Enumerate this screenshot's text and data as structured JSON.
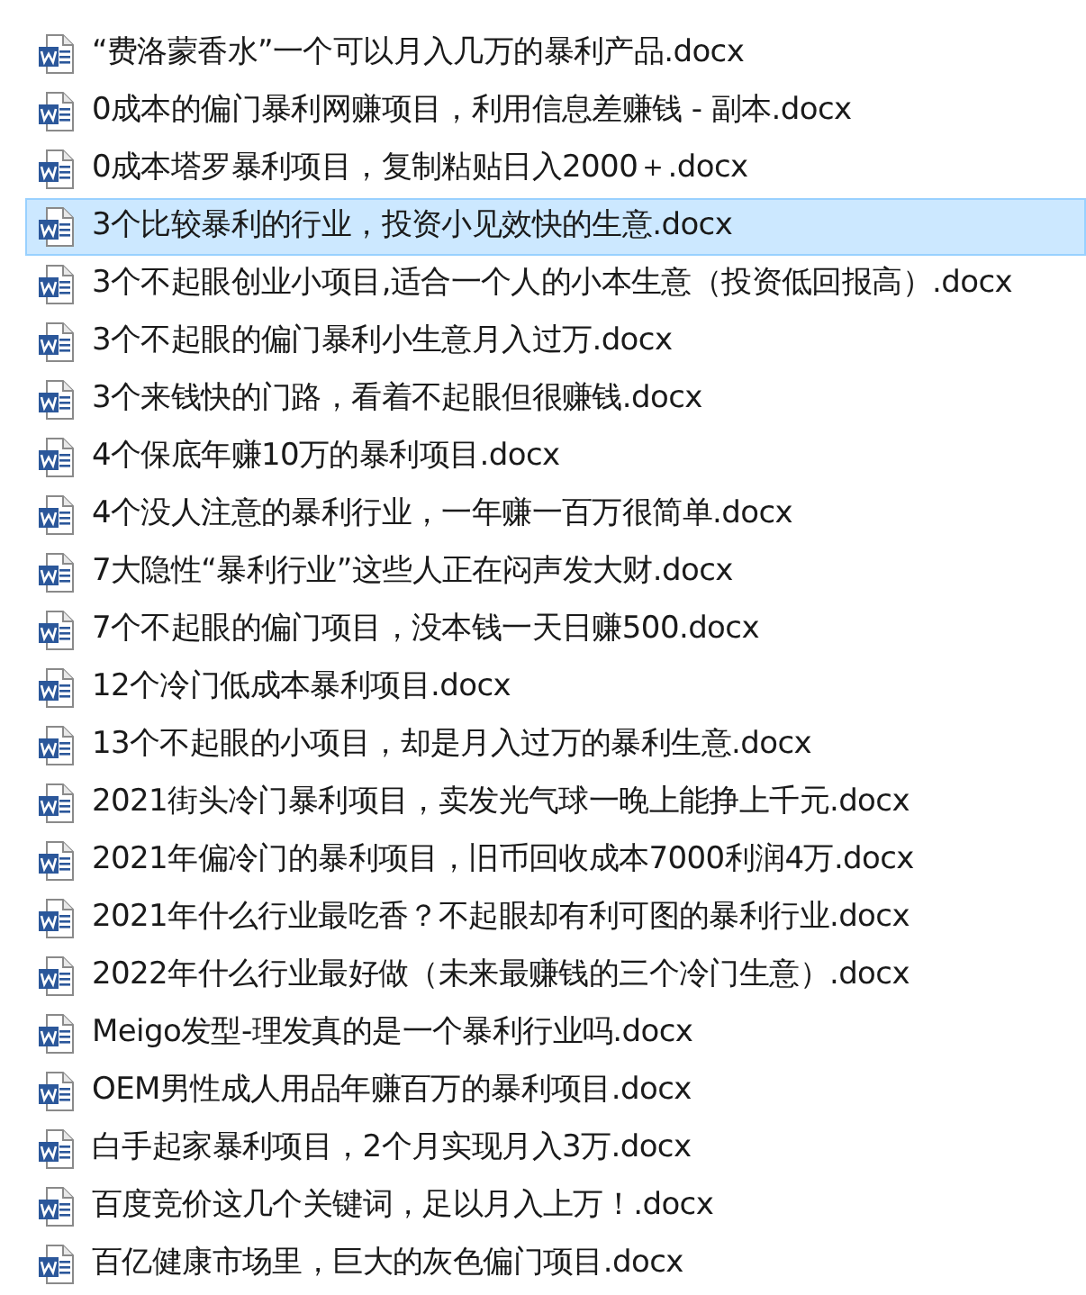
{
  "files": [
    {
      "name": "“费洛蒙香水”一个可以月入几万的暴利产品.docx",
      "selected": false
    },
    {
      "name": "0成本的偏门暴利网赚项目，利用信息差赚钱 - 副本.docx",
      "selected": false
    },
    {
      "name": "0成本塔罗暴利项目，复制粘贴日入2000＋.docx",
      "selected": false
    },
    {
      "name": "3个比较暴利的行业，投资小见效快的生意.docx",
      "selected": true
    },
    {
      "name": "3个不起眼创业小项目,适合一个人的小本生意（投资低回报高）.docx",
      "selected": false
    },
    {
      "name": "3个不起眼的偏门暴利小生意月入过万.docx",
      "selected": false
    },
    {
      "name": "3个来钱快的门路，看着不起眼但很赚钱.docx",
      "selected": false
    },
    {
      "name": "4个保底年赚10万的暴利项目.docx",
      "selected": false
    },
    {
      "name": "4个没人注意的暴利行业，一年赚一百万很简单.docx",
      "selected": false
    },
    {
      "name": "7大隐性“暴利行业”这些人正在闷声发大财.docx",
      "selected": false
    },
    {
      "name": "7个不起眼的偏门项目，没本钱一天日赚500.docx",
      "selected": false
    },
    {
      "name": "12个冷门低成本暴利项目.docx",
      "selected": false
    },
    {
      "name": "13个不起眼的小项目，却是月入过万的暴利生意.docx",
      "selected": false
    },
    {
      "name": "2021街头冷门暴利项目，卖发光气球一晚上能挣上千元.docx",
      "selected": false
    },
    {
      "name": "2021年偏冷门的暴利项目，旧币回收成本7000利润4万.docx",
      "selected": false
    },
    {
      "name": "2021年什么行业最吃香？不起眼却有利可图的暴利行业.docx",
      "selected": false
    },
    {
      "name": "2022年什么行业最好做（未来最赚钱的三个冷门生意）.docx",
      "selected": false
    },
    {
      "name": "Meigo发型-理发真的是一个暴利行业吗.docx",
      "selected": false
    },
    {
      "name": "OEM男性成人用品年赚百万的暴利项目.docx",
      "selected": false
    },
    {
      "name": "白手起家暴利项目，2个月实现月入3万.docx",
      "selected": false
    },
    {
      "name": "百度竞价这几个关键词，足以月入上万！.docx",
      "selected": false
    },
    {
      "name": "百亿健康市场里，巨大的灰色偏门项目.docx",
      "selected": false
    }
  ]
}
